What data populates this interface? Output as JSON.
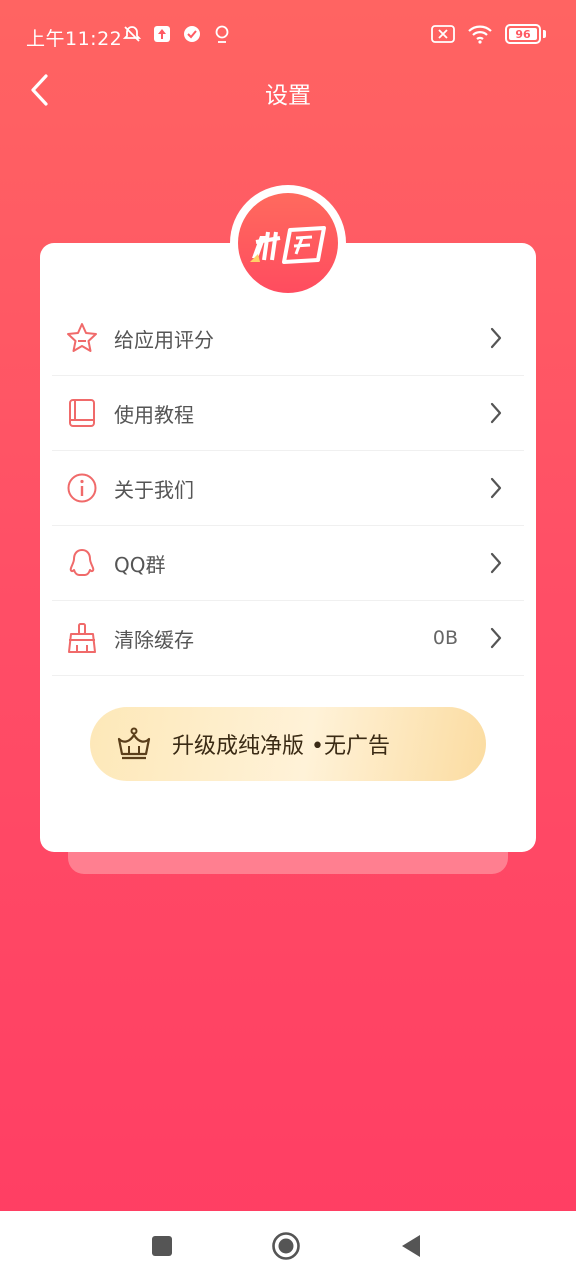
{
  "status_bar": {
    "time": "上午11:22",
    "battery": "96",
    "icons_left": [
      "mute-icon",
      "upload-icon",
      "check-circle-icon",
      "location-icon"
    ],
    "icons_right": [
      "no-sim-icon",
      "wifi-icon",
      "battery-icon"
    ]
  },
  "header": {
    "title": "设置"
  },
  "menu": {
    "items": [
      {
        "label": "给应用评分",
        "icon": "star-icon",
        "value": ""
      },
      {
        "label": "使用教程",
        "icon": "book-icon",
        "value": ""
      },
      {
        "label": "关于我们",
        "icon": "info-icon",
        "value": ""
      },
      {
        "label": "QQ群",
        "icon": "qq-penguin-icon",
        "value": ""
      },
      {
        "label": "清除缓存",
        "icon": "broom-icon",
        "value": "0B"
      }
    ]
  },
  "upgrade": {
    "label": "升级成纯净版 •无广告",
    "icon": "crown-icon"
  },
  "colors": {
    "accent": "#ff5a63",
    "icon": "#f06a6a",
    "upgrade_bg": "#fde8b8"
  }
}
